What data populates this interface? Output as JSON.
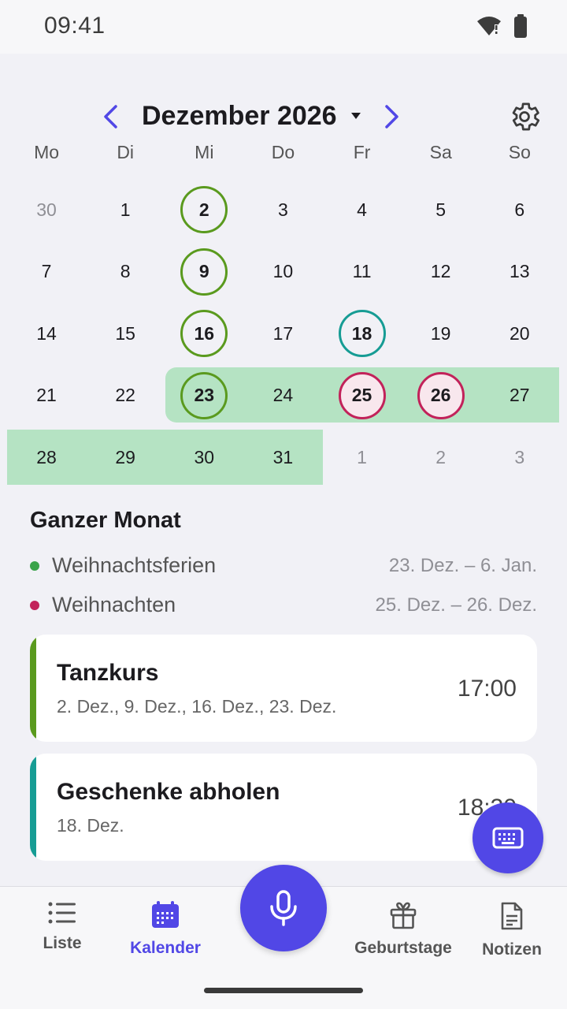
{
  "status_bar": {
    "time": "09:41"
  },
  "header": {
    "month_title": "Dezember 2026"
  },
  "weekdays": [
    "Mo",
    "Di",
    "Mi",
    "Do",
    "Fr",
    "Sa",
    "So"
  ],
  "weeks": [
    [
      {
        "label": "30",
        "muted": true
      },
      {
        "label": "1"
      },
      {
        "label": "2",
        "ring": "green"
      },
      {
        "label": "3"
      },
      {
        "label": "4"
      },
      {
        "label": "5"
      },
      {
        "label": "6"
      }
    ],
    [
      {
        "label": "7"
      },
      {
        "label": "8"
      },
      {
        "label": "9",
        "ring": "green"
      },
      {
        "label": "10"
      },
      {
        "label": "11"
      },
      {
        "label": "12"
      },
      {
        "label": "13"
      }
    ],
    [
      {
        "label": "14"
      },
      {
        "label": "15"
      },
      {
        "label": "16",
        "ring": "green"
      },
      {
        "label": "17"
      },
      {
        "label": "18",
        "ring": "teal"
      },
      {
        "label": "19"
      },
      {
        "label": "20"
      }
    ],
    [
      {
        "label": "21"
      },
      {
        "label": "22"
      },
      {
        "label": "23",
        "ring": "green"
      },
      {
        "label": "24"
      },
      {
        "label": "25",
        "ring": "red"
      },
      {
        "label": "26",
        "ring": "red"
      },
      {
        "label": "27"
      }
    ],
    [
      {
        "label": "28"
      },
      {
        "label": "29"
      },
      {
        "label": "30"
      },
      {
        "label": "31"
      },
      {
        "label": "1",
        "muted": true
      },
      {
        "label": "2",
        "muted": true
      },
      {
        "label": "3",
        "muted": true
      }
    ]
  ],
  "month_section": {
    "title": "Ganzer Monat",
    "ranges": [
      {
        "label": "Weihnachtsferien",
        "dates": "23. Dez. – 6. Jan.",
        "color": "#3aa34a"
      },
      {
        "label": "Weihnachten",
        "dates": "25. Dez. – 26. Dez.",
        "color": "#c2225a"
      }
    ]
  },
  "events": [
    {
      "title": "Tanzkurs",
      "dates": "2. Dez., 9. Dez., 16. Dez., 23. Dez.",
      "time": "17:00",
      "accent": "#5a9a1e"
    },
    {
      "title": "Geschenke abholen",
      "dates": "18. Dez.",
      "time": "18:30",
      "accent": "#169c94"
    }
  ],
  "bottom_nav": {
    "liste": "Liste",
    "kalender": "Kalender",
    "geburtstage": "Geburtstage",
    "notizen": "Notizen"
  },
  "colors": {
    "accent": "#5147e6",
    "highlight": "#b5e3c3"
  }
}
